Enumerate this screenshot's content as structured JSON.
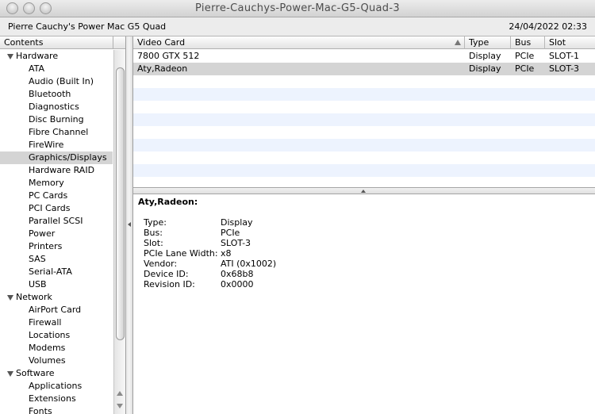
{
  "window": {
    "title": "Pierre-Cauchys-Power-Mac-G5-Quad-3"
  },
  "header": {
    "machine": "Pierre Cauchy's Power Mac G5 Quad",
    "date": "24/04/2022 02:33"
  },
  "sidebar": {
    "header": "Contents",
    "groups": [
      {
        "label": "Hardware",
        "items": [
          "ATA",
          "Audio (Built In)",
          "Bluetooth",
          "Diagnostics",
          "Disc Burning",
          "Fibre Channel",
          "FireWire",
          "Graphics/Displays",
          "Hardware RAID",
          "Memory",
          "PC Cards",
          "PCI Cards",
          "Parallel SCSI",
          "Power",
          "Printers",
          "SAS",
          "Serial-ATA",
          "USB"
        ]
      },
      {
        "label": "Network",
        "items": [
          "AirPort Card",
          "Firewall",
          "Locations",
          "Modems",
          "Volumes"
        ]
      },
      {
        "label": "Software",
        "items": [
          "Applications",
          "Extensions",
          "Fonts"
        ]
      }
    ],
    "selected": "Graphics/Displays"
  },
  "table": {
    "columns": [
      "Video Card",
      "Type",
      "Bus",
      "Slot"
    ],
    "rows": [
      {
        "name": "7800  GTX  512",
        "type": "Display",
        "bus": "PCIe",
        "slot": "SLOT-1"
      },
      {
        "name": "Aty,Radeon",
        "type": "Display",
        "bus": "PCIe",
        "slot": "SLOT-3"
      }
    ],
    "selected_row": 1
  },
  "detail": {
    "title": "Aty,Radeon:",
    "fields": [
      {
        "key": "Type:",
        "value": "Display"
      },
      {
        "key": "Bus:",
        "value": "PCIe"
      },
      {
        "key": "Slot:",
        "value": "SLOT-3"
      },
      {
        "key": "PCIe Lane Width:",
        "value": "x8"
      },
      {
        "key": "Vendor:",
        "value": "ATI (0x1002)"
      },
      {
        "key": "Device ID:",
        "value": "0x68b8"
      },
      {
        "key": "Revision ID:",
        "value": "0x0000"
      }
    ]
  }
}
